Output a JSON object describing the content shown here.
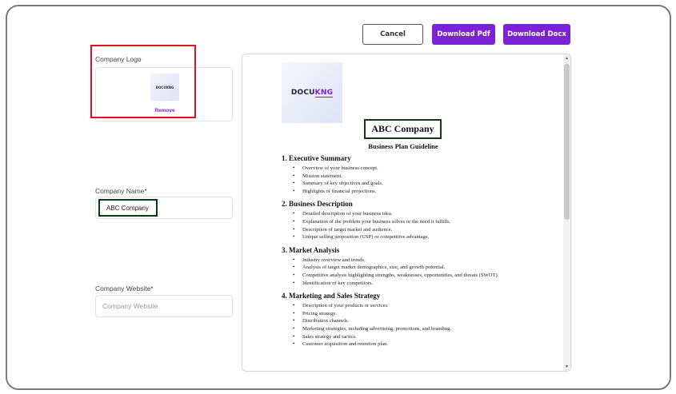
{
  "toolbar": {
    "cancel_label": "Cancel",
    "download_pdf_label": "Download Pdf",
    "download_docx_label": "Download Docx"
  },
  "form": {
    "logo_label": "Company Logo",
    "logo_thumb_text": "DOCUKNG",
    "remove_label": "Remove",
    "name_label": "Company Name*",
    "name_value": "ABC Company",
    "website_label": "Company Website*",
    "website_placeholder": "Company Website"
  },
  "preview": {
    "logo_text_main": "DOCU",
    "logo_text_accent": "KNG",
    "title": "ABC Company",
    "subtitle": "Business Plan Guideline",
    "sections": [
      {
        "heading": "1. Executive Summary",
        "items": [
          "Overview of your business concept.",
          "Mission statement.",
          "Summary of key objectives and goals.",
          "Highlights of financial projections."
        ]
      },
      {
        "heading": "2. Business Description",
        "items": [
          "Detailed description of your business idea.",
          "Explanation of the problem your business solves or the need it fulfills.",
          "Description of target market and audience.",
          "Unique selling proposition (USP) or competitive advantage."
        ]
      },
      {
        "heading": "3. Market Analysis",
        "items": [
          "Industry overview and trends.",
          "Analysis of target market demographics, size, and growth potential.",
          "Competitive analysis highlighting strengths, weaknesses, opportunities, and threats (SWOT).",
          "Identification of key competitors."
        ]
      },
      {
        "heading": "4. Marketing and Sales Strategy",
        "items": [
          "Description of your products or services.",
          "Pricing strategy.",
          "Distribution channels.",
          "Marketing strategies, including advertising, promotions, and branding.",
          "Sales strategy and tactics.",
          "Customer acquisition and retention plan."
        ]
      }
    ]
  },
  "colors": {
    "accent": "#7b22d8",
    "highlight_red": "#e0121b",
    "highlight_green": "#0b3a14"
  }
}
